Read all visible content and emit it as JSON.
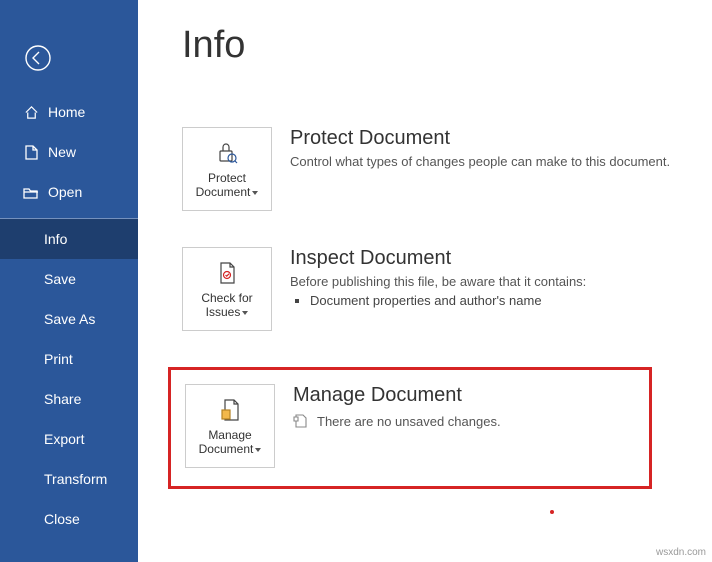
{
  "sidebar": {
    "items": [
      {
        "label": "Home"
      },
      {
        "label": "New"
      },
      {
        "label": "Open"
      },
      {
        "label": "Info"
      },
      {
        "label": "Save"
      },
      {
        "label": "Save As"
      },
      {
        "label": "Print"
      },
      {
        "label": "Share"
      },
      {
        "label": "Export"
      },
      {
        "label": "Transform"
      },
      {
        "label": "Close"
      }
    ]
  },
  "main": {
    "title": "Info",
    "protect": {
      "button_label": "Protect Document",
      "heading": "Protect Document",
      "desc": "Control what types of changes people can make to this document."
    },
    "inspect": {
      "button_label": "Check for Issues",
      "heading": "Inspect Document",
      "desc": "Before publishing this file, be aware that it contains:",
      "items": [
        "Document properties and author's name"
      ]
    },
    "manage": {
      "button_label": "Manage Document",
      "heading": "Manage Document",
      "desc": "There are no unsaved changes."
    }
  },
  "watermark": "wsxdn.com"
}
